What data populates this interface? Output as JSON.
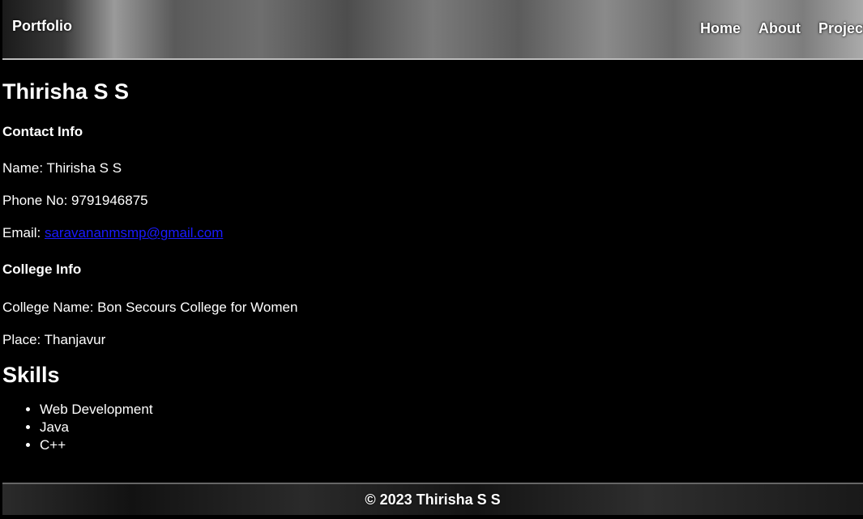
{
  "nav": {
    "brand": "Portfolio",
    "links": [
      "Home",
      "About",
      "Project"
    ]
  },
  "profile": {
    "name": "Thirisha S S",
    "contact_heading": "Contact Info",
    "contact_name": "Name: Thirisha S S",
    "phone": "Phone No: 9791946875",
    "email_label": "Email: ",
    "email": "saravananmsmp@gmail.com",
    "college_heading": "College Info",
    "college_name": "College Name: Bon Secours College for Women",
    "place": "Place: Thanjavur"
  },
  "skills": {
    "heading": "Skills",
    "items": [
      "Web Development",
      "Java",
      "C++"
    ]
  },
  "footer": {
    "text": "© 2023 Thirisha S S"
  },
  "colors": {
    "background": "#000000",
    "text": "#ffffff",
    "link": "#1a1aff"
  }
}
